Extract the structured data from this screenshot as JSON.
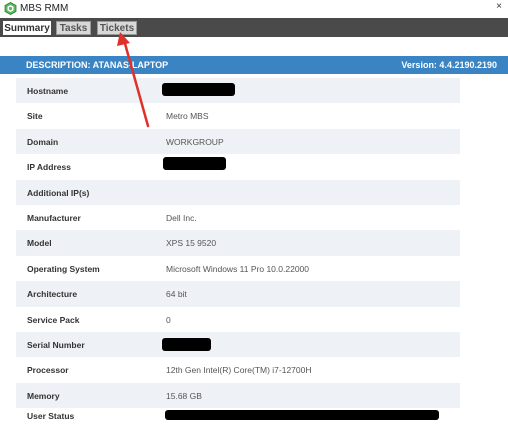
{
  "window": {
    "title": "MBS RMM",
    "close_glyph": "×",
    "icon": "mbs-logo-icon"
  },
  "tabs": [
    {
      "label": "Summary",
      "active": true
    },
    {
      "label": "Tasks",
      "active": false
    },
    {
      "label": "Tickets",
      "active": false
    }
  ],
  "header": {
    "description": "DESCRIPTION: ATANAS-LAPTOP",
    "version": "Version:  4.4.2190.2190",
    "color": "#3a84c4"
  },
  "details": [
    {
      "label": "Hostname",
      "value": "",
      "redacted": true
    },
    {
      "label": "Site",
      "value": "Metro MBS"
    },
    {
      "label": "Domain",
      "value": "WORKGROUP"
    },
    {
      "label": "IP Address",
      "value": "",
      "redacted": true
    },
    {
      "label": "Additional IP(s)",
      "value": ""
    },
    {
      "label": "Manufacturer",
      "value": "Dell Inc."
    },
    {
      "label": "Model",
      "value": "XPS 15 9520"
    },
    {
      "label": "Operating System",
      "value": "Microsoft Windows 11 Pro 10.0.22000"
    },
    {
      "label": "Architecture",
      "value": "64 bit"
    },
    {
      "label": "Service Pack",
      "value": "0"
    },
    {
      "label": "Serial Number",
      "value": "",
      "redacted": true
    },
    {
      "label": "Processor",
      "value": "12th Gen Intel(R) Core(TM) i7-12700H"
    },
    {
      "label": "Memory",
      "value": "15.68 GB"
    },
    {
      "label": "User Status",
      "value": "",
      "redacted": true
    }
  ],
  "annotation": {
    "color": "#e0302a",
    "target": "Tickets tab"
  }
}
